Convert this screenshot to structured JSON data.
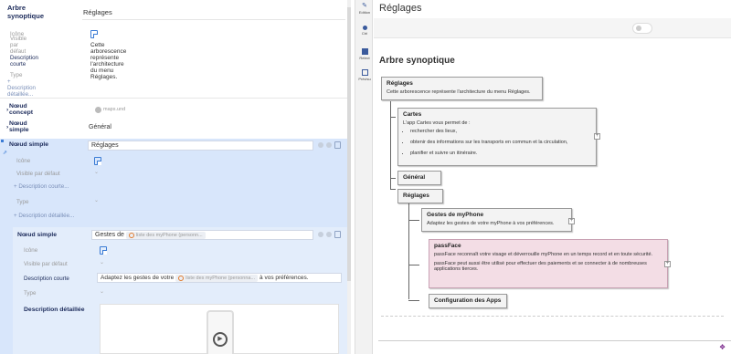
{
  "left": {
    "top_title": "Arbre synoptique",
    "top_value": "Réglages",
    "fields": {
      "icone": "Icône",
      "visible": "Visible par défaut",
      "desc_courte": "Description courte",
      "type": "Type",
      "desc_detaillee": "+ Description détaillée..."
    },
    "desc_courte_value": "Cette arborescence représente l'architecture du menu Réglages.",
    "noeud_concept": "Nœud concept",
    "maps_tag": "maps.und",
    "noeud_simple_1": "Nœud simple",
    "noeud_simple_1_value": "Général",
    "noeud_simple_2": "Nœud simple",
    "noeud_simple_2_value": "Réglages",
    "inner_node": "Nœud simple",
    "inner_value_prefix": "Gestes de",
    "inner_value_tag": "liste des myPhone (personn...",
    "inner_desc_prefix": "Adaptez les gestes de votre",
    "inner_desc_tag": "liste des myPhone (personna...",
    "inner_desc_suffix": "à vos préférences.",
    "desc_detaillee_label": "Description détaillée"
  },
  "toolbar": {
    "edition": "Edition",
    "ctrl": "Ctrl",
    "relect": "Relect",
    "previsu": "Prévisu"
  },
  "right": {
    "title": "Réglages",
    "page_title": "Arbre synoptique",
    "root": {
      "title": "Réglages",
      "desc": "Cette arborescence représente l'architecture du menu Réglages."
    },
    "cartes": {
      "title": "Cartes",
      "intro": "L'app Cartes vous permet de :",
      "items": [
        "rechercher des lieux,",
        "obtenir des informations sur les transports en commun et la circulation,",
        "planifier et suivre un itinéraire."
      ]
    },
    "general": "Général",
    "reglages": "Réglages",
    "gestes": {
      "title": "Gestes de myPhone",
      "desc": "Adaptez les gestes de votre myPhone à vos préférences."
    },
    "passface": {
      "title": "passFace",
      "desc1": "passFace reconnaît votre visage et déverrouille myPhone en un temps record et en toute sécurité.",
      "desc2": "passFace peut aussi être utilisé pour effectuer des paiements et se connecter à de nombreuses applications tierces."
    },
    "config": "Configuration des Apps"
  },
  "colors": {
    "accent_blue": "#3a7bd5",
    "selected_bg": "#d8e6fb",
    "pink_node": "#f3dde5",
    "brand": "#7b2a8c"
  }
}
